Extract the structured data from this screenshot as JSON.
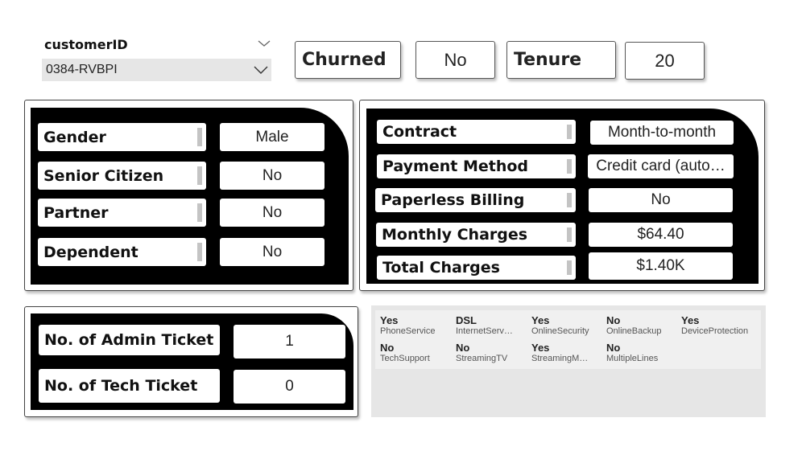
{
  "slicer": {
    "title": "customerID",
    "value": "0384-RVBPI"
  },
  "cards": {
    "churned_label": "Churned",
    "churned_value": "No",
    "tenure_label": "Tenure",
    "tenure_value": "20"
  },
  "demographics": [
    {
      "label": "Gender",
      "value": "Male"
    },
    {
      "label": "Senior Citizen",
      "value": "No"
    },
    {
      "label": "Partner",
      "value": "No"
    },
    {
      "label": "Dependent",
      "value": "No"
    }
  ],
  "account": [
    {
      "label": "Contract",
      "value": "Month-to-month"
    },
    {
      "label": "Payment Method",
      "value": "Credit card (auto…"
    },
    {
      "label": "Paperless Billing",
      "value": "No"
    },
    {
      "label": "Monthly Charges",
      "value": "$64.40"
    },
    {
      "label": "Total Charges",
      "value": "$1.40K"
    }
  ],
  "tickets": [
    {
      "label": "No. of Admin Ticket",
      "value": "1"
    },
    {
      "label": "No. of Tech Ticket",
      "value": "0"
    }
  ],
  "services": [
    {
      "value": "Yes",
      "name": "PhoneService"
    },
    {
      "value": "DSL",
      "name": "InternetServ…"
    },
    {
      "value": "Yes",
      "name": "OnlineSecurity"
    },
    {
      "value": "No",
      "name": "OnlineBackup"
    },
    {
      "value": "Yes",
      "name": "DeviceProtection"
    },
    {
      "value": "No",
      "name": "TechSupport"
    },
    {
      "value": "No",
      "name": "StreamingTV"
    },
    {
      "value": "Yes",
      "name": "StreamingM…"
    },
    {
      "value": "No",
      "name": "MultipleLines"
    }
  ]
}
